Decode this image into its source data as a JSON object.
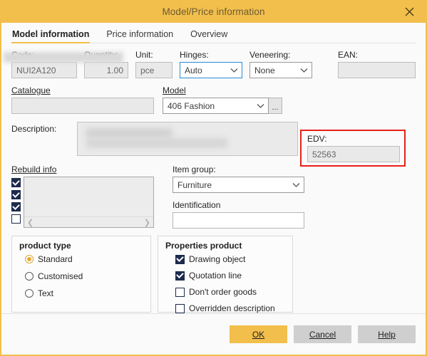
{
  "window": {
    "title": "Model/Price information",
    "close_icon": "close-icon",
    "accent_color": "#f2bf4c",
    "highlight_color": "#e8201a"
  },
  "tabs": [
    {
      "label": "Model information",
      "active": true
    },
    {
      "label": "Price information",
      "active": false
    },
    {
      "label": "Overview",
      "active": false
    }
  ],
  "fields": {
    "code": {
      "label": "Code:",
      "value": "NUI2A120",
      "readonly": true
    },
    "quantity": {
      "label": "Quantity:",
      "value": "1.00",
      "readonly": true
    },
    "unit": {
      "label": "Unit:",
      "value": "pce",
      "readonly": true
    },
    "hinges": {
      "label": "Hinges:",
      "value": "Auto",
      "chevron": "chevron-down-icon"
    },
    "veneering": {
      "label": "Veneering:",
      "value": "None",
      "chevron": "chevron-down-icon"
    },
    "ean": {
      "label": "EAN:",
      "value": "",
      "readonly": true
    },
    "catalogue": {
      "label": "Catalogue",
      "value": "",
      "readonly": true
    },
    "model": {
      "label": "Model",
      "value": "406 Fashion",
      "chevron": "chevron-down-icon",
      "browse_label": "..."
    },
    "edv": {
      "label": "EDV:",
      "value": "52563",
      "readonly": true,
      "highlighted": true
    },
    "description": {
      "label": "Description:",
      "value": ""
    },
    "identification": {
      "label": "Identification",
      "value": ""
    },
    "item_group": {
      "label": "Item group:",
      "value": "Furniture",
      "chevron": "chevron-down-icon"
    }
  },
  "rebuild_info": {
    "label": "Rebuild info",
    "checkboxes": [
      true,
      true,
      true,
      false
    ],
    "scroll_left_icon": "chevron-left-icon",
    "scroll_right_icon": "chevron-right-icon"
  },
  "product_type": {
    "title": "product type",
    "options": [
      {
        "label": "Standard",
        "selected": true
      },
      {
        "label": "Customised",
        "selected": false
      },
      {
        "label": "Text",
        "selected": false
      }
    ]
  },
  "properties_product": {
    "title": "Properties product",
    "options": [
      {
        "label": "Drawing object",
        "checked": true
      },
      {
        "label": "Quotation line",
        "checked": true
      },
      {
        "label": "Don't order goods",
        "checked": false
      },
      {
        "label": "Overridden description",
        "checked": false
      }
    ]
  },
  "footer": {
    "ok": "OK",
    "cancel": "Cancel",
    "help": "Help"
  }
}
